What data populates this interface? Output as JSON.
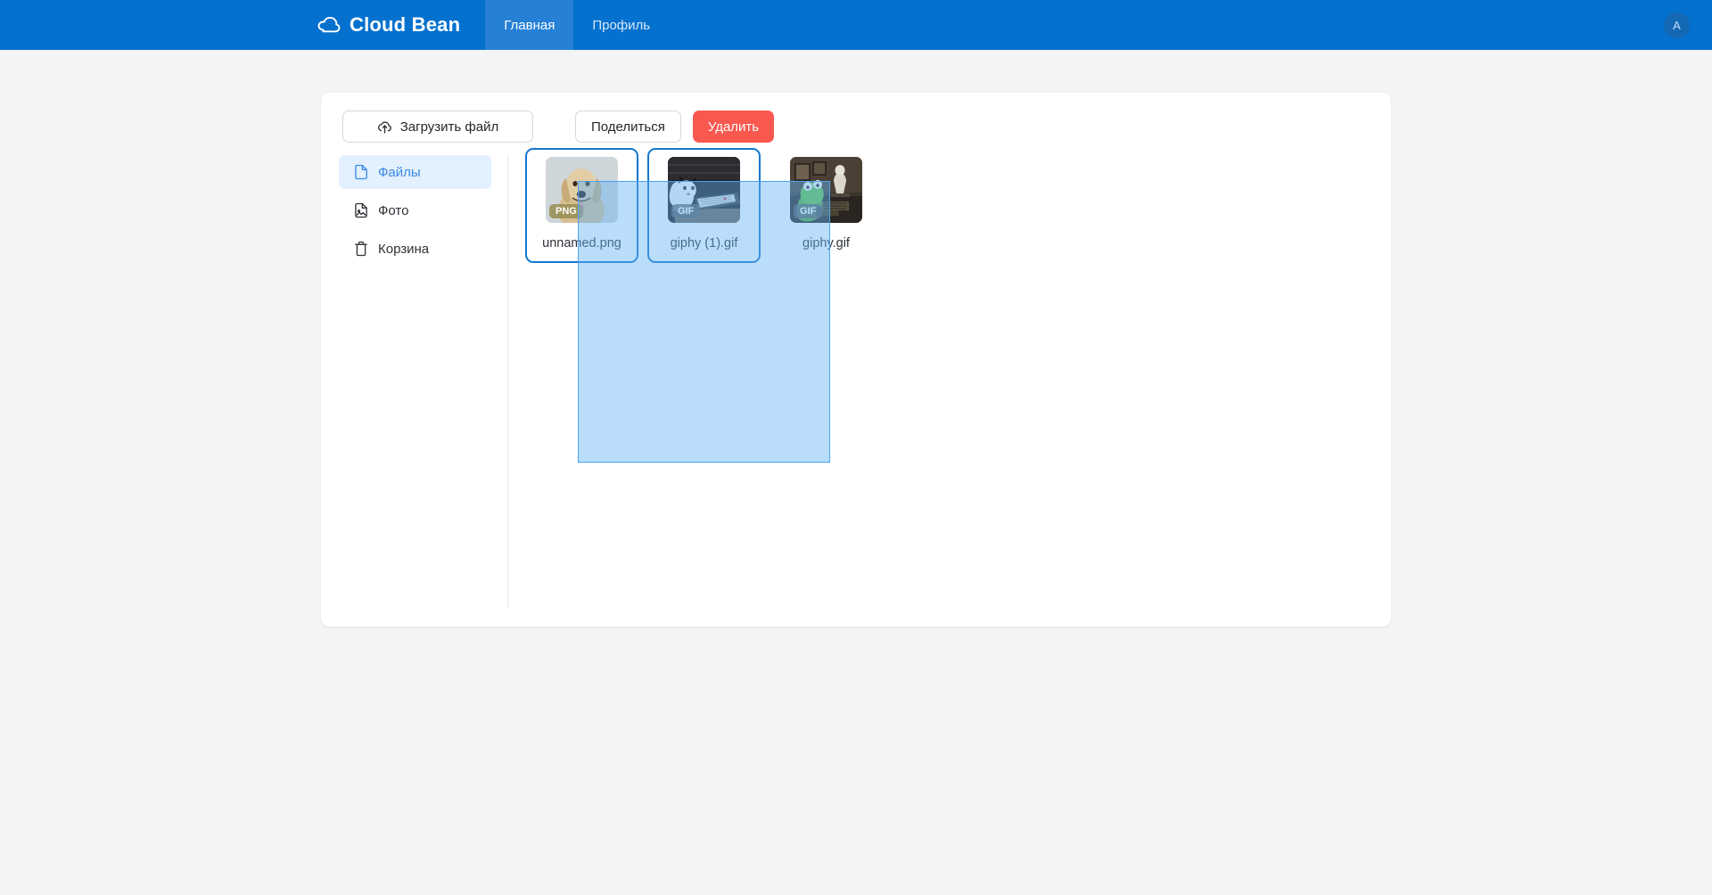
{
  "navbar": {
    "brand": "Cloud Bean",
    "brand_icon": "cloud-icon",
    "tabs": [
      {
        "label": "Главная",
        "active": true
      },
      {
        "label": "Профиль",
        "active": false
      }
    ],
    "avatar_initial": "A",
    "background_color": "#0571ce",
    "active_tab_color": "#2580d6"
  },
  "toolbar": {
    "upload_label": "Загрузить файл",
    "upload_icon": "cloud-upload-icon",
    "share_label": "Поделиться",
    "delete_label": "Удалить",
    "delete_color": "#f9584f"
  },
  "sidebar": {
    "items": [
      {
        "label": "Файлы",
        "icon": "file-icon",
        "active": true
      },
      {
        "label": "Фото",
        "icon": "image-file-icon",
        "active": false
      },
      {
        "label": "Корзина",
        "icon": "trash-icon",
        "active": false
      }
    ],
    "active_color": "#3b8ae6",
    "active_background": "#e3f0fd"
  },
  "files": [
    {
      "name": "unnamed.png",
      "badge": "PNG",
      "thumb": "dog-photo",
      "selected": true
    },
    {
      "name": "giphy (1).gif",
      "badge": "GIF",
      "thumb": "cat-keyboard-gif",
      "selected": true
    },
    {
      "name": "giphy.gif",
      "badge": "GIF",
      "thumb": "frog-typewriter-gif",
      "selected": false
    }
  ],
  "selection_marquee": {
    "visible": true,
    "fill_color": "#65b4f6",
    "border_color": "#4ba3f0"
  }
}
